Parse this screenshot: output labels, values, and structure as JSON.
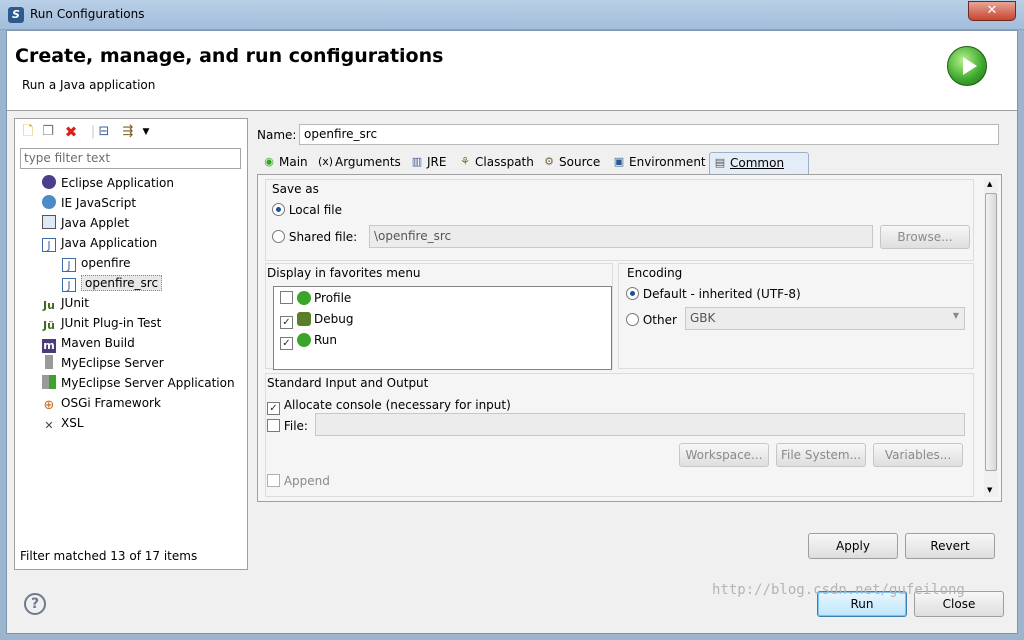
{
  "window": {
    "title": "Run Configurations",
    "close_label": "✕"
  },
  "header": {
    "title": "Create, manage, and run configurations",
    "subtitle": "Run a Java application"
  },
  "left": {
    "filter_placeholder": "type filter text",
    "items": [
      {
        "label": "Eclipse Application",
        "icon": "eclipse-icon"
      },
      {
        "label": "IE JavaScript",
        "icon": "globe-icon"
      },
      {
        "label": "Java Applet",
        "icon": "applet-icon"
      },
      {
        "label": "Java Application",
        "icon": "java-app-icon"
      },
      {
        "label": "openfire",
        "icon": "java-config-icon"
      },
      {
        "label": "openfire_src",
        "icon": "java-config-icon"
      },
      {
        "label": "JUnit",
        "icon": "junit-icon"
      },
      {
        "label": "JUnit Plug-in Test",
        "icon": "junit-plugin-icon"
      },
      {
        "label": "Maven Build",
        "icon": "maven-icon"
      },
      {
        "label": "MyEclipse Server",
        "icon": "server-icon"
      },
      {
        "label": "MyEclipse Server Application",
        "icon": "server-app-icon"
      },
      {
        "label": "OSGi Framework",
        "icon": "osgi-icon"
      },
      {
        "label": "XSL",
        "icon": "xsl-icon"
      }
    ],
    "filter_message": "Filter matched 13 of 17 items"
  },
  "config": {
    "name_label": "Name:",
    "name_value": "openfire_src",
    "tabs": [
      "Main",
      "Arguments",
      "JRE",
      "Classpath",
      "Source",
      "Environment",
      "Common"
    ],
    "active_tab": "Common",
    "save_as": {
      "title": "Save as",
      "local_file": "Local file",
      "shared_file": "Shared file:",
      "shared_value": "\\openfire_src",
      "browse": "Browse..."
    },
    "favorites": {
      "title": "Display in favorites menu",
      "items": [
        {
          "label": "Profile",
          "checked": false
        },
        {
          "label": "Debug",
          "checked": true
        },
        {
          "label": "Run",
          "checked": true
        }
      ]
    },
    "encoding": {
      "title": "Encoding",
      "default_label": "Default - inherited (UTF-8)",
      "other_label": "Other",
      "other_value": "GBK"
    },
    "std_io": {
      "title": "Standard Input and Output",
      "allocate_label": "Allocate console (necessary for input)",
      "file_label": "File:",
      "workspace": "Workspace...",
      "file_system": "File System...",
      "variables": "Variables...",
      "append_label": "Append"
    },
    "apply": "Apply",
    "revert": "Revert"
  },
  "footer": {
    "run": "Run",
    "close": "Close",
    "help": "?"
  },
  "watermark": "http://blog.csdn.net/gufeilong"
}
